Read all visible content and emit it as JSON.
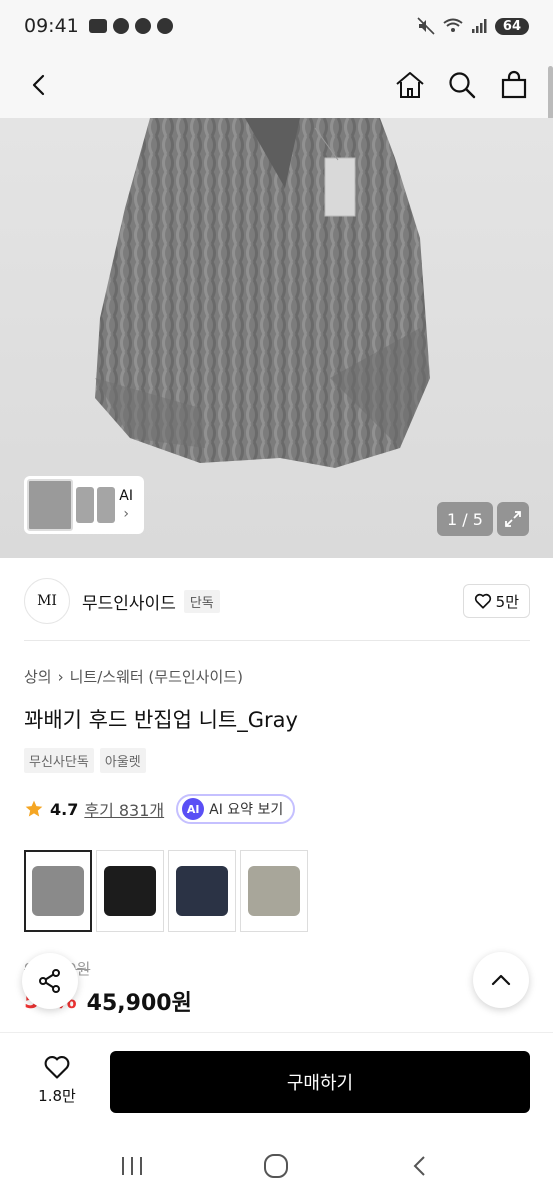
{
  "status_bar": {
    "time": "09:41",
    "battery": "64"
  },
  "nav": {
    "back": "back",
    "home": "home",
    "search": "search",
    "cart": "cart"
  },
  "gallery": {
    "counter": "1 / 5",
    "ai_label": "AI",
    "ai_arrow": "›"
  },
  "brand": {
    "logo": "MI",
    "name": "무드인사이드",
    "badge": "단독",
    "likes": "5만"
  },
  "breadcrumb": {
    "category": "상의",
    "separator": "›",
    "subcategory": "니트/스웨터 (무드인사이드)"
  },
  "product": {
    "title": "꽈배기 후드 반집업 니트_Gray",
    "tags": [
      "무신사단독",
      "아울렛"
    ],
    "rating": "4.7",
    "reviews": "후기 831개",
    "ai_badge": "AI",
    "ai_summary": "AI 요약 보기",
    "original_price": "91,800원",
    "discount": "50%",
    "sale_price": "45,900원"
  },
  "colors": {
    "swatch_colors": [
      "#8a8a8a",
      "#1c1c1c",
      "#2b3345",
      "#a8a69a"
    ]
  },
  "bottom_bar": {
    "wish_count": "1.8만",
    "buy_label": "구매하기"
  }
}
